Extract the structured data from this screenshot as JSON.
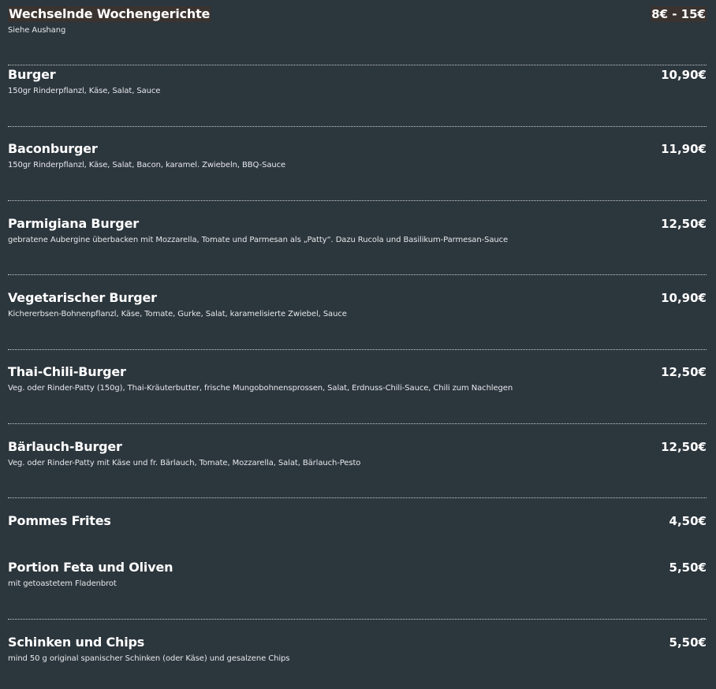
{
  "menu": {
    "items": [
      {
        "name": "Wechselnde Wochengerichte",
        "price": "8€ - 15€",
        "description": "Siehe Aushang"
      },
      {
        "name": "Burger",
        "price": "10,90€",
        "description": "150gr Rinderpflanzl, Käse, Salat, Sauce"
      },
      {
        "name": "Baconburger",
        "price": "11,90€",
        "description": "150gr Rinderpflanzl, Käse, Salat, Bacon, karamel. Zwiebeln, BBQ-Sauce"
      },
      {
        "name": "Parmigiana Burger",
        "price": "12,50€",
        "description": "gebratene Aubergine überbacken mit Mozzarella, Tomate und Parmesan als „Patty“. Dazu Rucola und Basilikum-Parmesan-Sauce"
      },
      {
        "name": "Vegetarischer Burger",
        "price": "10,90€",
        "description": "Kichererbsen-Bohnenpflanzl, Käse, Tomate, Gurke, Salat, karamelisierte Zwiebel, Sauce"
      },
      {
        "name": "Thai-Chili-Burger",
        "price": "12,50€",
        "description": "Veg. oder Rinder-Patty (150g), Thai-Kräuterbutter, frische Mungobohnensprossen, Salat, Erdnuss-Chili-Sauce, Chili zum Nachlegen"
      },
      {
        "name": "Bärlauch-Burger",
        "price": "12,50€",
        "description": "Veg. oder Rinder-Patty mit Käse und fr. Bärlauch, Tomate, Mozzarella, Salat, Bärlauch-Pesto"
      },
      {
        "name": "Pommes Frites",
        "price": "4,50€",
        "description": ""
      },
      {
        "name": "Portion Feta und Oliven",
        "price": "5,50€",
        "description": "mit getoastetem Fladenbrot"
      },
      {
        "name": "Schinken und Chips",
        "price": "5,50€",
        "description": "mind 50 g original spanischer Schinken (oder Käse) und gesalzene Chips"
      }
    ]
  }
}
